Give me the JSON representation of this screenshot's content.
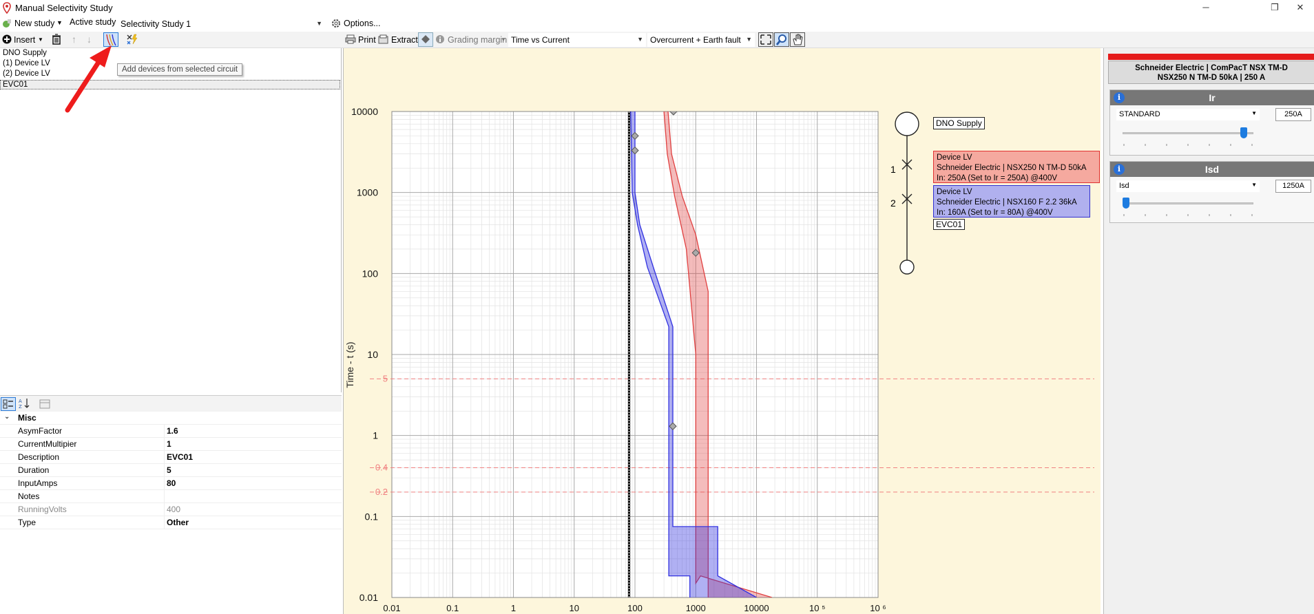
{
  "window": {
    "title": "Manual Selectivity Study"
  },
  "studybar": {
    "new_study": "New study",
    "active_study_label": "Active study",
    "active_study_value": "Selectivity Study 1",
    "options": "Options..."
  },
  "toolbar": {
    "insert": "Insert",
    "print": "Print",
    "extract": "Extract",
    "grading_margin": "Grading margin",
    "chart_mode": "Time vs Current",
    "fault_type": "Overcurrent + Earth fault"
  },
  "tooltip": "Add devices from selected circuit",
  "tree": {
    "items": [
      "DNO Supply",
      "(1) Device LV",
      "(2) Device LV",
      "EVC01"
    ]
  },
  "properties": {
    "category": "Misc",
    "rows": [
      {
        "name": "AsymFactor",
        "value": "1.6"
      },
      {
        "name": "CurrentMultipier",
        "value": "1"
      },
      {
        "name": "Description",
        "value": "EVC01"
      },
      {
        "name": "Duration",
        "value": "5"
      },
      {
        "name": "InputAmps",
        "value": "80"
      },
      {
        "name": "Notes",
        "value": ""
      },
      {
        "name": "RunningVolts",
        "value": "400"
      },
      {
        "name": "Type",
        "value": "Other"
      }
    ]
  },
  "chart_data": {
    "type": "line",
    "ylabel": "Time - t (s)",
    "xlabel": "",
    "x_scale": "log",
    "y_scale": "log",
    "xlim": [
      0.01,
      1000000
    ],
    "ylim": [
      0.01,
      10000
    ],
    "x_tick_labels": [
      "0.01",
      "0.1",
      "1",
      "10",
      "100",
      "1000",
      "10000",
      "10 ⁵",
      "10 ⁶"
    ],
    "y_tick_labels": [
      "10000",
      "1000",
      "100",
      "10",
      "1",
      "0.1",
      "0.01"
    ],
    "reference_lines": [
      {
        "y": 5,
        "label": "5"
      },
      {
        "y": 0.4,
        "label": "0.4"
      },
      {
        "y": 0.2,
        "label": "0.2"
      }
    ],
    "marker_x": 80,
    "series": [
      {
        "name": "Device LV (NSX250 N TM-D 50kA)",
        "color": "#e04040",
        "upper": [
          [
            350,
            10000
          ],
          [
            400,
            3000
          ],
          [
            600,
            900
          ],
          [
            1000,
            300
          ],
          [
            1600,
            60
          ],
          [
            1600,
            0.01
          ]
        ],
        "lower": [
          [
            300,
            10000
          ],
          [
            340,
            3000
          ],
          [
            450,
            900
          ],
          [
            700,
            200
          ],
          [
            1000,
            10
          ],
          [
            1000,
            0.015
          ],
          [
            1200,
            0.0185
          ],
          [
            18000,
            0.01
          ]
        ]
      },
      {
        "name": "Device LV (NSX160 F 2.2 36kA)",
        "color": "#3030e0",
        "upper": [
          [
            100,
            10000
          ],
          [
            100,
            1000
          ],
          [
            120,
            400
          ],
          [
            200,
            120
          ],
          [
            420,
            22
          ],
          [
            420,
            0.075
          ],
          [
            2300,
            0.075
          ],
          [
            2300,
            0.0185
          ],
          [
            10000,
            0.01
          ]
        ],
        "lower": [
          [
            85,
            10000
          ],
          [
            90,
            1000
          ],
          [
            110,
            400
          ],
          [
            160,
            120
          ],
          [
            360,
            22
          ],
          [
            360,
            0.0185
          ],
          [
            800,
            0.0185
          ],
          [
            800,
            0.01
          ]
        ]
      }
    ],
    "diamonds": [
      [
        430,
        10000
      ],
      [
        100,
        5000
      ],
      [
        100,
        3300
      ],
      [
        1000,
        180
      ],
      [
        420,
        1.3
      ]
    ]
  },
  "diagram": {
    "supply_label": "DNO Supply",
    "nodes": [
      {
        "num": "1",
        "line1": "Device LV",
        "line2": "Schneider Electric | NSX250 N TM-D 50kA",
        "line3": "In: 250A (Set to Ir = 250A) @400V",
        "bg": "#f5a99f",
        "border": "#e03030"
      },
      {
        "num": "2",
        "line1": "Device LV",
        "line2": "Schneider Electric | NSX160 F 2.2 36kA",
        "line3": "In: 160A (Set to Ir = 80A) @400V",
        "bg": "#b0b0ee",
        "border": "#3030d0"
      }
    ],
    "load_label": "EVC01"
  },
  "device_panel": {
    "header_line1": "Schneider Electric | ComPacT NSX TM-D",
    "header_line2": "NSX250 N TM-D 50kA | 250 A",
    "ir": {
      "title": "Ir",
      "mode": "STANDARD",
      "value": "250A",
      "slider_fraction": 0.95
    },
    "isd": {
      "title": "Isd",
      "mode": "Isd",
      "value": "1250A",
      "slider_fraction": 0.0
    }
  }
}
